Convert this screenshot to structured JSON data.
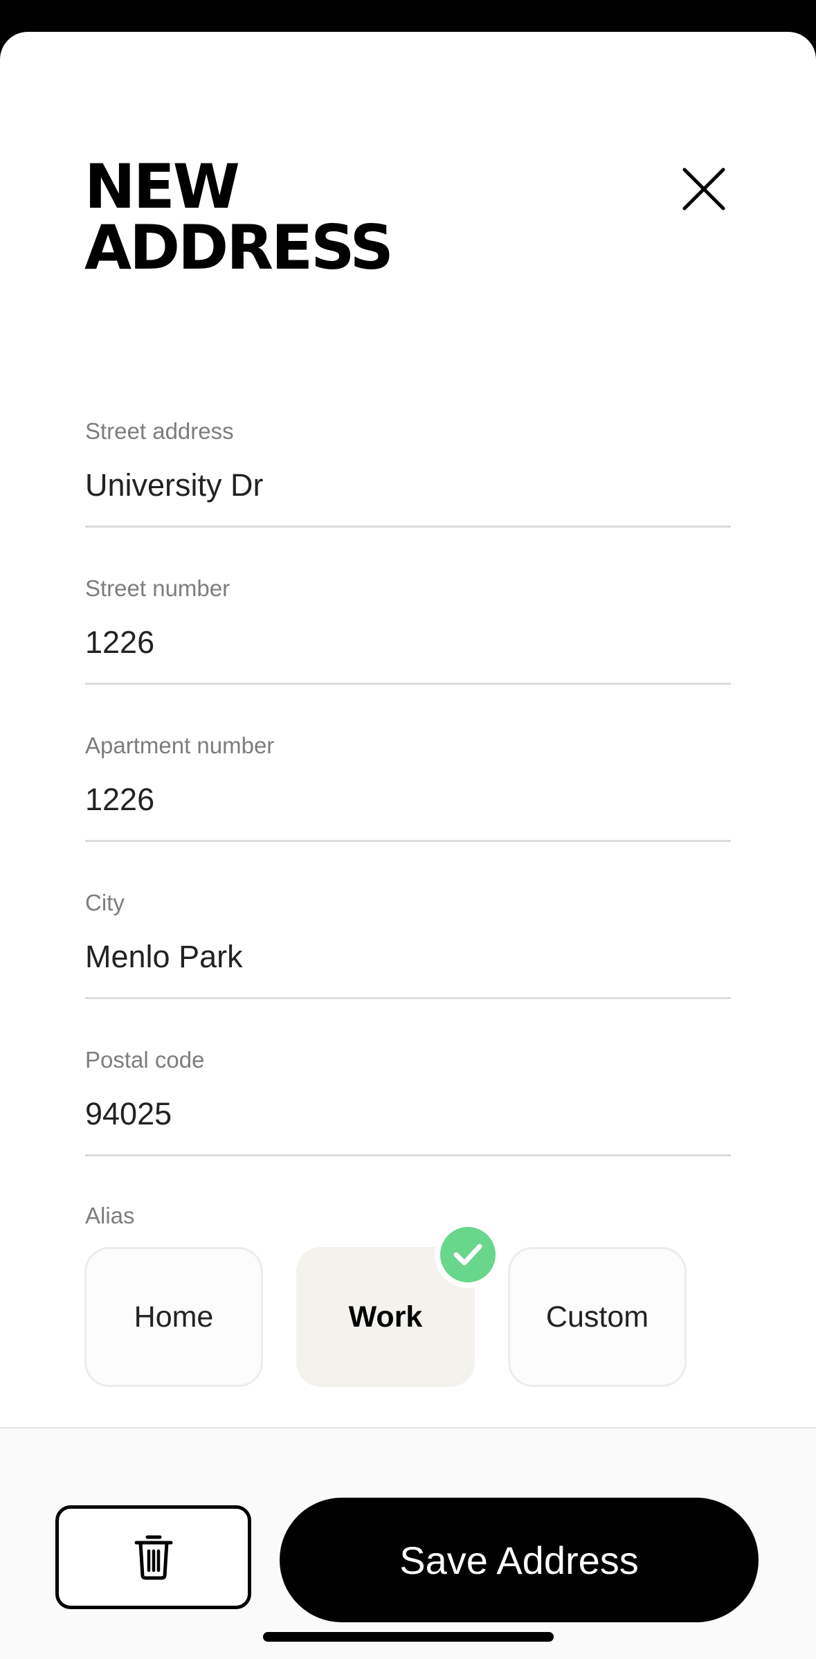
{
  "header": {
    "title_line1": "NEW",
    "title_line2": "ADDRESS",
    "close_icon": "close-icon"
  },
  "form": {
    "fields": [
      {
        "label": "Street address",
        "value": "University Dr"
      },
      {
        "label": "Street number",
        "value": "1226"
      },
      {
        "label": "Apartment number",
        "value": "1226"
      },
      {
        "label": "City",
        "value": "Menlo Park"
      },
      {
        "label": "Postal code",
        "value": "94025"
      }
    ],
    "alias": {
      "label": "Alias",
      "options": [
        "Home",
        "Work",
        "Custom"
      ],
      "selected": "Work",
      "check_color": "#68d68b"
    }
  },
  "footer": {
    "delete_icon": "trash-icon",
    "save_label": "Save Address"
  },
  "colors": {
    "primary": "#000000",
    "selected_chip_bg": "#f3f2ec",
    "label_gray": "#7d7d7d"
  }
}
